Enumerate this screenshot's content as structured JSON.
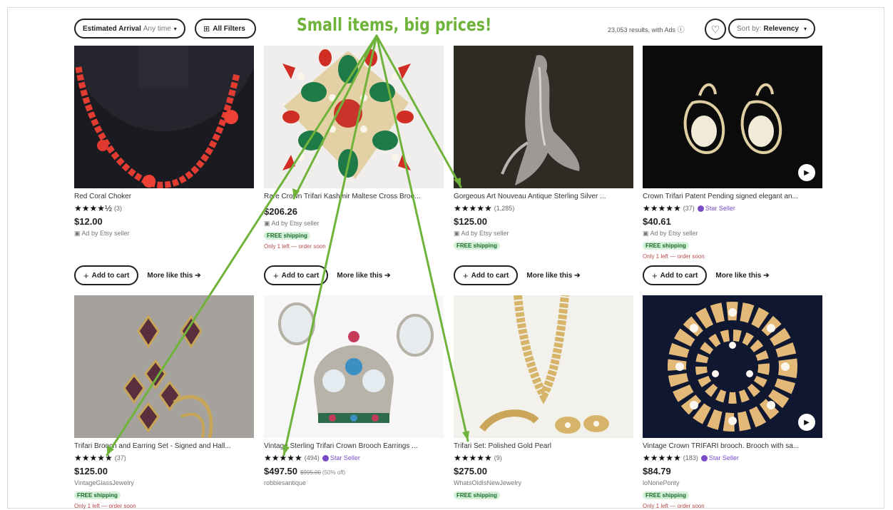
{
  "filters": {
    "arrival_label": "Estimated Arrival",
    "arrival_value": "Any time",
    "all_filters": "All Filters",
    "caret_glyph": "▾",
    "filter_glyph": "⊞"
  },
  "headline": "Small items, big prices!",
  "results": {
    "text": "23,053 results, with Ads",
    "info_glyph": "ⓘ"
  },
  "sort": {
    "label": "Sort by:",
    "value": "Relevency"
  },
  "glyphs": {
    "heart": "♡",
    "plus": "+",
    "play": "▶",
    "arrow": "➔"
  },
  "actions": {
    "add_to_cart": "Add to cart",
    "more_like_this": "More like this"
  },
  "listings": [
    {
      "title": "Red Coral Choker",
      "stars": "★★★★½",
      "count": "(3)",
      "price": "$12.00",
      "seller": "▣ Ad by Etsy seller"
    },
    {
      "title": "Rare Crown Trifari Kashmir Maltese Cross Broo...",
      "stars": "",
      "count": "",
      "price": "$206.26",
      "seller": "▣ Ad by Etsy seller",
      "free": "FREE shipping",
      "scarce": "Only 1 left — order soon"
    },
    {
      "title": "Gorgeous Art Nouveau Antique Sterling Silver ...",
      "stars": "★★★★★",
      "count": "(1,285)",
      "price": "$125.00",
      "seller": "▣ Ad by Etsy seller",
      "free": "FREE shipping"
    },
    {
      "title": "Crown Trifari Patent Pending signed elegant an...",
      "stars": "★★★★★",
      "count": "(37)",
      "star_seller": "Star Seller",
      "price": "$40.61",
      "seller": "▣ Ad by Etsy seller",
      "free": "FREE shipping",
      "scarce": "Only 1 left — order soon"
    },
    {
      "title": "Trifari Brooch and Earring Set - Signed and Hall...",
      "stars": "★★★★★",
      "count": "(37)",
      "price": "$125.00",
      "seller": "VintageGlassJewelry",
      "free": "FREE shipping",
      "scarce": "Only 1 left — order soon"
    },
    {
      "title": "Vintage Sterling Trifari Crown Brooch Earrings ...",
      "stars": "★★★★★",
      "count": "(494)",
      "star_seller": "Star Seller",
      "price": "$497.50",
      "old_price": "$995.00",
      "pct": "(50% off)",
      "seller": "robbiesantique"
    },
    {
      "title": "Trifari Set: Polished Gold Pearl",
      "stars": "★★★★★",
      "count": "(9)",
      "price": "$275.00",
      "seller": "WhatsOldIsNewJewelry",
      "free": "FREE shipping"
    },
    {
      "title": "Vintage Crown TRIFARI brooch. Brooch with sa...",
      "stars": "★★★★★",
      "count": "(183)",
      "star_seller": "Star Seller",
      "price": "$84.79",
      "seller": "loNonePonty",
      "free": "FREE shipping",
      "scarce": "Only 1 left — order soon"
    }
  ],
  "colors": {
    "accent_green": "#6fb33b",
    "star_seller_purple": "#7a4bc8",
    "free_badge_bg": "#d4f0d8"
  }
}
